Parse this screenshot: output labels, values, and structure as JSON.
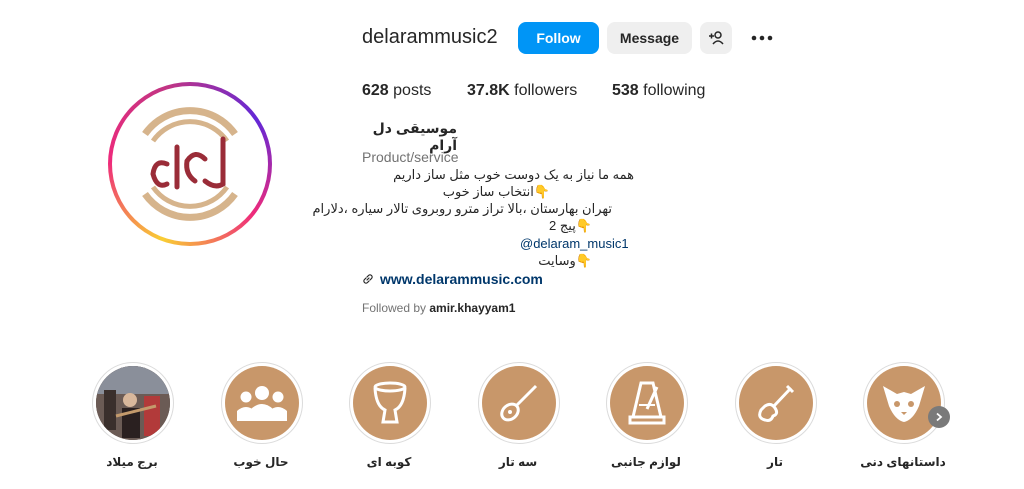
{
  "profile": {
    "username": "delarammusic2",
    "follow_label": "Follow",
    "message_label": "Message",
    "posts_count": "628",
    "posts_label": "posts",
    "followers_count": "37.8K",
    "followers_label": "followers",
    "following_count": "538",
    "following_label": "following",
    "display_name": "موسیقی دل آرام",
    "category": "Product/service",
    "bio_lines": [
      "همه ما نیاز به یک دوست خوب مثل ساز داریم",
      "انتخاب ساز خوب",
      "تهران بهارستان ،بالا تراز مترو روبروی تالار سیاره ،دلارام",
      "پیج 2"
    ],
    "bio_handle": "@delaram_music1",
    "bio_last": "وسایت",
    "website": "www.delarammusic.com",
    "followed_by_prefix": "Followed by",
    "followed_by_user": "amir.khayyam1"
  },
  "highlights": [
    {
      "label": "برج میلاد",
      "icon": "photo"
    },
    {
      "label": "حال خوب",
      "icon": "people-icon"
    },
    {
      "label": "کوبه ای",
      "icon": "drum-icon"
    },
    {
      "label": "سه تار",
      "icon": "setar-icon"
    },
    {
      "label": "لوازم جانبی",
      "icon": "metronome-icon"
    },
    {
      "label": "تار",
      "icon": "tar-icon"
    },
    {
      "label": "داستانهای دنی",
      "icon": "fox-icon"
    }
  ],
  "colors": {
    "follow_button": "#0095f6",
    "highlight_bg": "#c8976a",
    "link": "#00376b"
  }
}
